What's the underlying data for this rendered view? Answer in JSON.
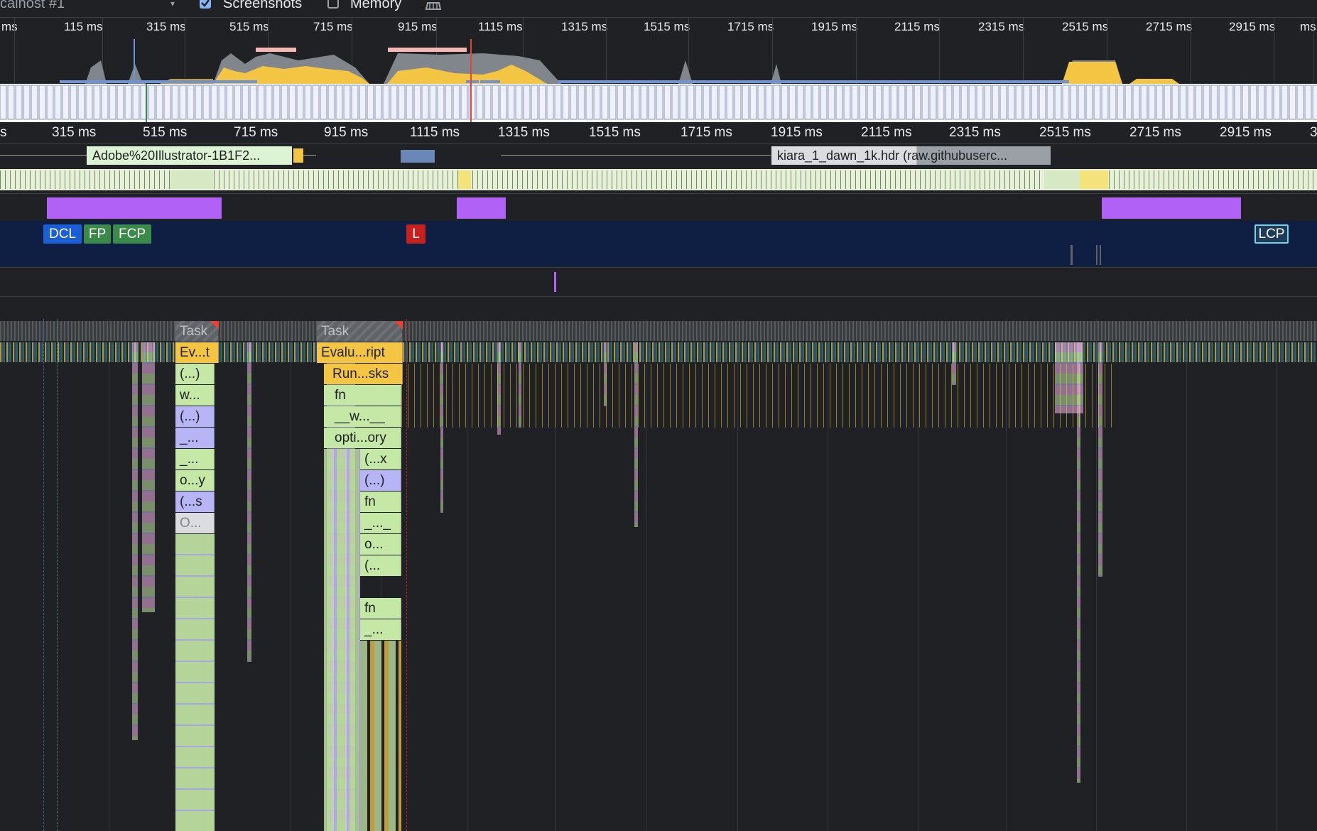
{
  "toolbar": {
    "target_label": "calhost #1",
    "screenshots_label": "Screenshots",
    "screenshots_checked": true,
    "memory_label": "Memory",
    "memory_checked": false,
    "cleanup_icon": "broom-icon"
  },
  "overview": {
    "ticks": [
      "ms",
      "115 ms",
      "315 ms",
      "515 ms",
      "715 ms",
      "915 ms",
      "1115 ms",
      "1315 ms",
      "1515 ms",
      "1715 ms",
      "1915 ms",
      "2115 ms",
      "2315 ms",
      "2515 ms",
      "2715 ms",
      "2915 ms",
      "ms"
    ]
  },
  "main_ruler": {
    "ticks": [
      "s",
      "315 ms",
      "515 ms",
      "715 ms",
      "915 ms",
      "1115 ms",
      "1315 ms",
      "1515 ms",
      "1715 ms",
      "1915 ms",
      "2115 ms",
      "2315 ms",
      "2515 ms",
      "2715 ms",
      "2915 ms",
      "3"
    ]
  },
  "network": {
    "request_1": "Adobe%20Illustrator-1B1F2...",
    "request_2": "kiara_1_dawn_1k.hdr (raw.githubuserc..."
  },
  "timings": {
    "dcl": "DCL",
    "fp": "FP",
    "fcp": "FCP",
    "load": "L",
    "lcp": "LCP"
  },
  "main_thread": {
    "left_column": [
      "Task",
      "Ev...t",
      "(...)",
      "w...",
      "(...)",
      "_...",
      "_...",
      "o...y",
      "(...s",
      "O..."
    ],
    "right_column": [
      "Task",
      "Evalu...ript",
      "Run...sks",
      "fn",
      "__w...__",
      "opti...ory",
      "(...x",
      "(...)",
      "fn",
      "_..._",
      "o...",
      "(...",
      "fn",
      "_..."
    ]
  },
  "colors": {
    "background": "#202124",
    "script_yellow": "#f4c542",
    "task_gray": "#5f6368",
    "function_green": "#c5e8a7",
    "function_purple": "#b7b5f5",
    "interaction_purple": "#b161f5",
    "timings_navy": "#0f1f44",
    "dcl_blue": "#1a5fd6",
    "fp_green": "#3a8a4a",
    "load_red": "#c5221f",
    "lcp_teal": "#7bd0e5"
  }
}
